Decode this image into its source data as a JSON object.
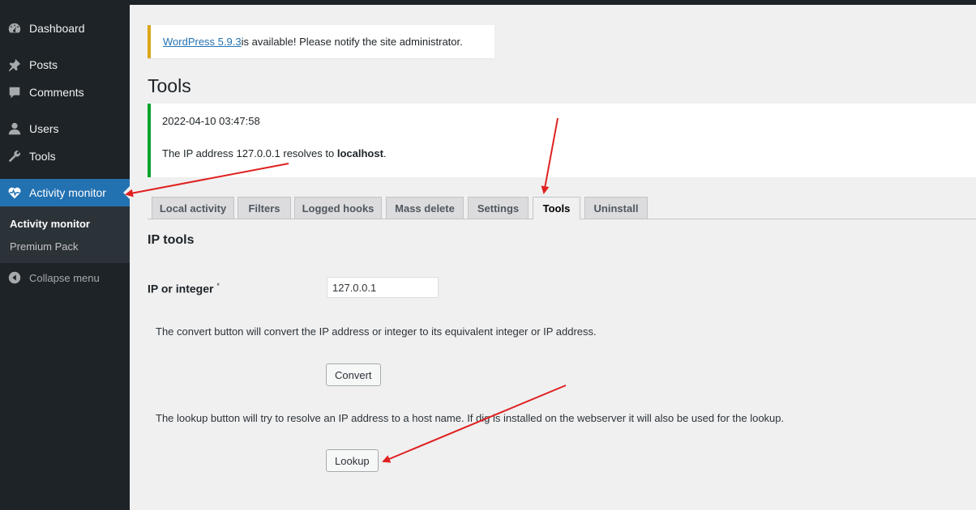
{
  "sidebar": {
    "items": [
      {
        "label": "Dashboard",
        "icon": "dashboard-icon"
      },
      {
        "label": "Posts",
        "icon": "pin-icon"
      },
      {
        "label": "Comments",
        "icon": "comment-icon"
      },
      {
        "label": "Users",
        "icon": "user-icon"
      },
      {
        "label": "Tools",
        "icon": "wrench-icon"
      },
      {
        "label": "Activity monitor",
        "icon": "heartbeat-icon",
        "active": true
      }
    ],
    "submenu": [
      "Activity monitor",
      "Premium Pack"
    ],
    "collapse_label": "Collapse menu"
  },
  "notice": {
    "link": "WordPress 5.9.3",
    "text": " is available! Please notify the site administrator."
  },
  "page_title": "Tools",
  "result": {
    "timestamp": "2022-04-10 03:47:58",
    "prefix": "The IP address 127.0.0.1 resolves to ",
    "host": "localhost",
    "suffix": "."
  },
  "tabs": [
    "Local activity",
    "Filters",
    "Logged hooks",
    "Mass delete",
    "Settings",
    "Tools",
    "Uninstall"
  ],
  "active_tab": "Tools",
  "ip_tools": {
    "title": "IP tools",
    "field_label": "IP or integer",
    "required_mark": "*",
    "field_value": "127.0.0.1",
    "convert_desc": "The convert button will convert the IP address or integer to its equivalent integer or IP address.",
    "convert_label": "Convert",
    "lookup_desc": "The lookup button will try to resolve an IP address to a host name. If dig is installed on the webserver it will also be used for the lookup.",
    "lookup_label": "Lookup"
  },
  "colors": {
    "sidebar_bg": "#1d2327",
    "active_menu": "#2271b1",
    "notice_border": "#dba617",
    "success_border": "#00a32a",
    "annotation_arrow": "#e02020"
  }
}
